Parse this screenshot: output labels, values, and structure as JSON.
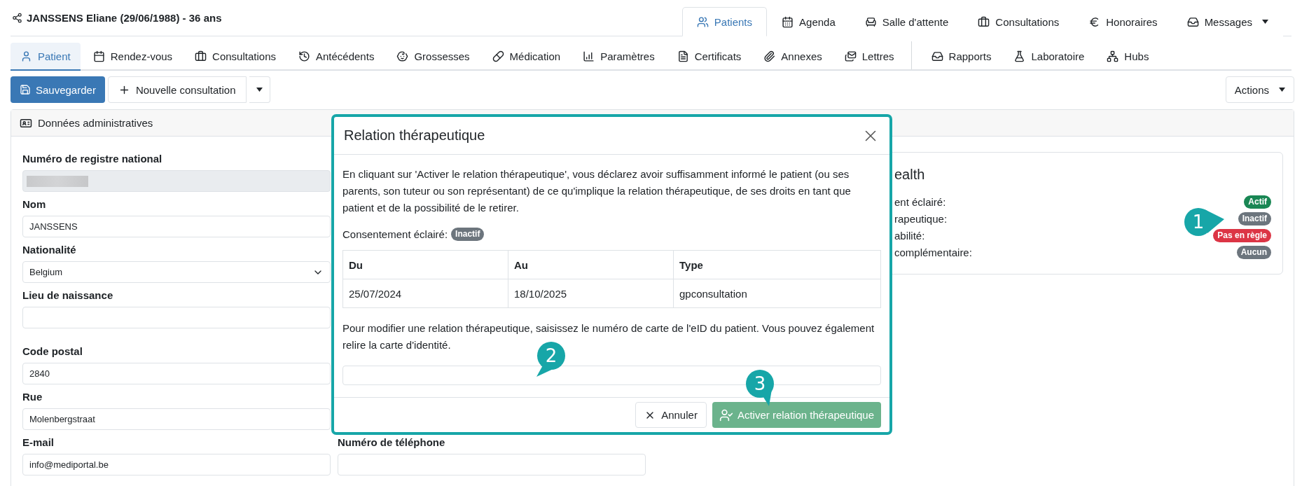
{
  "patient_header": {
    "name": "JANSSENS Eliane (29/06/1988) - 36 ans"
  },
  "main_tabs": [
    {
      "label": "Patients",
      "selected": true,
      "dropdown": false
    },
    {
      "label": "Agenda",
      "selected": false,
      "dropdown": false
    },
    {
      "label": "Salle d'attente",
      "selected": false,
      "dropdown": false
    },
    {
      "label": "Consultations",
      "selected": false,
      "dropdown": false
    },
    {
      "label": "Honoraires",
      "selected": false,
      "dropdown": false
    },
    {
      "label": "Messages",
      "selected": false,
      "dropdown": true
    }
  ],
  "sub_tab_groups": [
    {
      "tabs": [
        {
          "label": "Patient",
          "selected": true
        },
        {
          "label": "Rendez-vous",
          "selected": false
        },
        {
          "label": "Consultations",
          "selected": false
        },
        {
          "label": "Antécédents",
          "selected": false
        },
        {
          "label": "Grossesses",
          "selected": false
        },
        {
          "label": "Médication",
          "selected": false
        },
        {
          "label": "Paramètres",
          "selected": false
        },
        {
          "label": "Certificats",
          "selected": false
        },
        {
          "label": "Annexes",
          "selected": false
        },
        {
          "label": "Lettres",
          "selected": false
        }
      ]
    },
    {
      "tabs": [
        {
          "label": "Rapports",
          "selected": false
        },
        {
          "label": "Laboratoire",
          "selected": false
        },
        {
          "label": "Hubs",
          "selected": false
        }
      ]
    }
  ],
  "toolbar": {
    "save": "Sauvegarder",
    "new_consultation": "Nouvelle consultation",
    "actions": "Actions"
  },
  "card": {
    "title": "Données administratives",
    "field_groups": [
      [
        {
          "kind": "masked",
          "label": "Numéro de registre national"
        },
        {
          "kind": "text",
          "label": "Nom",
          "value": "JANSSENS"
        },
        {
          "kind": "select",
          "label": "Nationalité",
          "value": "Belgium"
        },
        {
          "kind": "text",
          "label": "Lieu de naissance"
        }
      ],
      [
        {
          "kind": "text",
          "label": "Code postal",
          "value": "2840"
        },
        {
          "kind": "text",
          "label": "Rue",
          "value": "Molenbergstraat"
        },
        {
          "kind": "text",
          "label": "E-mail",
          "value": "info@mediportal.be"
        }
      ]
    ],
    "second_column": [
      {
        "kind": "text",
        "label": "Numéro de téléphone"
      }
    ],
    "ehealth": {
      "title": "ealth",
      "rows": [
        {
          "label": "ent éclairé:",
          "status": "Actif",
          "color": "#198754"
        },
        {
          "label": "rapeutique:",
          "status": "Inactif",
          "color": "#6c757d"
        },
        {
          "label": "abilité:",
          "status": "Pas en règle",
          "color": "#dc3545"
        },
        {
          "label": "complémentaire:",
          "status": "Aucun",
          "color": "#6c757d"
        }
      ]
    }
  },
  "modal": {
    "title": "Relation thérapeutique",
    "intro": "En cliquant sur 'Activer le relation thérapeutique', vous déclarez avoir suffisamment informé le patient (ou ses parents, son tuteur ou son représentant) de ce qu'implique la relation thérapeutique, de ses droits en tant que patient et de la possibilité de le retirer.",
    "consent_label": "Consentement éclairé:",
    "consent_status": "Inactif",
    "table": {
      "columns": [
        "Du",
        "Au",
        "Type"
      ],
      "rows": [
        [
          "25/07/2024",
          "18/10/2025",
          "gpconsultation"
        ]
      ]
    },
    "hint": "Pour modifier une relation thérapeutique, saisissez le numéro de carte de l'eID du patient. Vous pouvez également relire la carte d'identité.",
    "cancel": "Annuler",
    "activate": {
      "label": "Activer relation thérapeutique",
      "disabled": true
    }
  },
  "callouts": [
    {
      "label": "1"
    },
    {
      "label": "2"
    },
    {
      "label": "3"
    }
  ]
}
